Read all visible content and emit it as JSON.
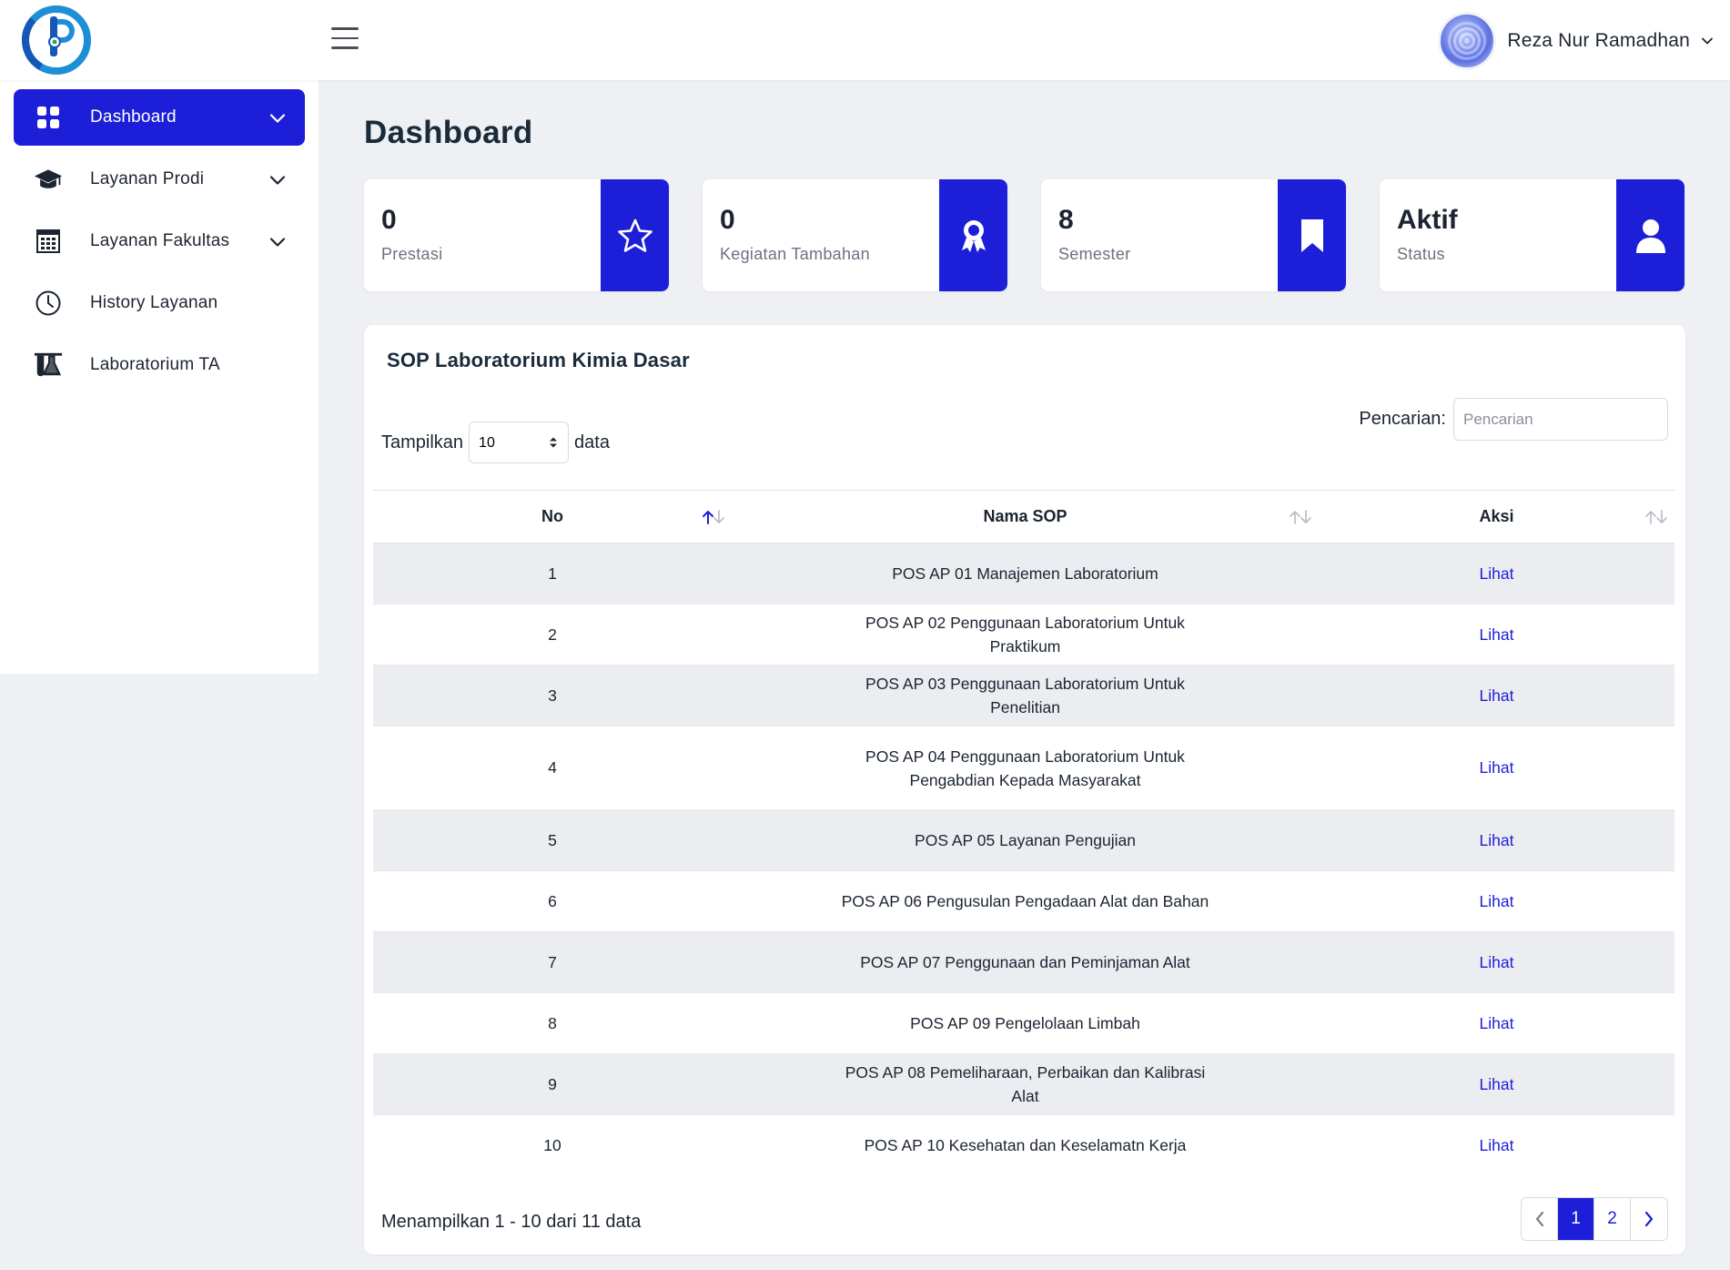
{
  "user": {
    "name": "Reza Nur Ramadhan"
  },
  "sidebar": {
    "items": [
      {
        "label": "Dashboard",
        "icon": "grid-icon",
        "active": true,
        "has_submenu": true
      },
      {
        "label": "Layanan Prodi",
        "icon": "graduation-cap-icon",
        "active": false,
        "has_submenu": true
      },
      {
        "label": "Layanan Fakultas",
        "icon": "building-icon",
        "active": false,
        "has_submenu": true
      },
      {
        "label": "History Layanan",
        "icon": "clock-icon",
        "active": false,
        "has_submenu": false
      },
      {
        "label": "Laboratorium TA",
        "icon": "flask-icon",
        "active": false,
        "has_submenu": false
      }
    ]
  },
  "page": {
    "title": "Dashboard"
  },
  "stats": [
    {
      "value": "0",
      "label": "Prestasi",
      "icon": "star-icon"
    },
    {
      "value": "0",
      "label": "Kegiatan Tambahan",
      "icon": "award-icon"
    },
    {
      "value": "8",
      "label": "Semester",
      "icon": "bookmark-icon"
    },
    {
      "value": "Aktif",
      "label": "Status",
      "icon": "user-icon"
    }
  ],
  "sop": {
    "title": "SOP Laboratorium Kimia Dasar",
    "length": {
      "prefix": "Tampilkan",
      "value": "10",
      "suffix": "data"
    },
    "search": {
      "label": "Pencarian:",
      "placeholder": "Pencarian"
    },
    "columns": [
      "No",
      "Nama SOP",
      "Aksi"
    ],
    "rows": [
      {
        "no": "1",
        "name": "POS AP 01 Manajemen Laboratorium",
        "action": "Lihat"
      },
      {
        "no": "2",
        "name": "POS AP 02 Penggunaan Laboratorium Untuk Praktikum",
        "action": "Lihat"
      },
      {
        "no": "3",
        "name": "POS AP 03 Penggunaan Laboratorium Untuk Penelitian",
        "action": "Lihat"
      },
      {
        "no": "4",
        "name": "POS AP 04 Penggunaan Laboratorium Untuk Pengabdian Kepada Masyarakat",
        "action": "Lihat"
      },
      {
        "no": "5",
        "name": "POS AP 05 Layanan Pengujian",
        "action": "Lihat"
      },
      {
        "no": "6",
        "name": "POS AP 06 Pengusulan Pengadaan Alat dan Bahan",
        "action": "Lihat"
      },
      {
        "no": "7",
        "name": "POS AP 07 Penggunaan dan Peminjaman Alat",
        "action": "Lihat"
      },
      {
        "no": "8",
        "name": "POS AP 09 Pengelolaan Limbah",
        "action": "Lihat"
      },
      {
        "no": "9",
        "name": "POS AP 08 Pemeliharaan, Perbaikan dan Kalibrasi Alat",
        "action": "Lihat"
      },
      {
        "no": "10",
        "name": "POS AP 10 Kesehatan dan Keselamatn Kerja",
        "action": "Lihat"
      }
    ],
    "info": "Menampilkan 1 - 10 dari 11 data",
    "pagination": {
      "pages": [
        "1",
        "2"
      ],
      "current": "1"
    }
  },
  "colors": {
    "primary": "#1d1ed8",
    "background": "#eef0f4",
    "row_stripe": "#ecedf1"
  }
}
